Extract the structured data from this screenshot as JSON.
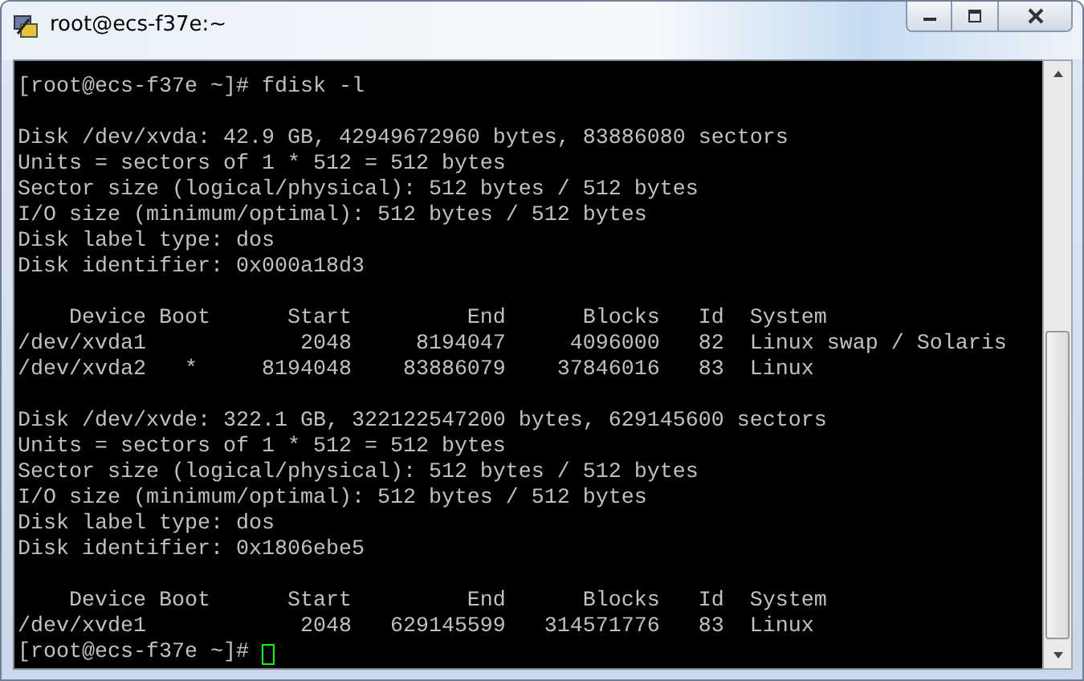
{
  "window": {
    "title": "root@ecs-f37e:~"
  },
  "terminal": {
    "blocks": [
      {
        "lines": [
          "[root@ecs-f37e ~]# fdisk -l"
        ]
      },
      {
        "lines": [
          "Disk /dev/xvda: 42.9 GB, 42949672960 bytes, 83886080 sectors",
          "Units = sectors of 1 * 512 = 512 bytes",
          "Sector size (logical/physical): 512 bytes / 512 bytes",
          "I/O size (minimum/optimal): 512 bytes / 512 bytes",
          "Disk label type: dos",
          "Disk identifier: 0x000a18d3"
        ]
      },
      {
        "lines": [
          "    Device Boot      Start         End      Blocks   Id  System",
          "/dev/xvda1            2048     8194047     4096000   82  Linux swap / Solaris",
          "/dev/xvda2   *     8194048    83886079    37846016   83  Linux"
        ]
      },
      {
        "lines": [
          "Disk /dev/xvde: 322.1 GB, 322122547200 bytes, 629145600 sectors",
          "Units = sectors of 1 * 512 = 512 bytes",
          "Sector size (logical/physical): 512 bytes / 512 bytes",
          "I/O size (minimum/optimal): 512 bytes / 512 bytes",
          "Disk label type: dos",
          "Disk identifier: 0x1806ebe5"
        ]
      },
      {
        "lines": [
          "    Device Boot      Start         End      Blocks   Id  System",
          "/dev/xvde1            2048   629145599   314571776   83  Linux"
        ]
      }
    ],
    "prompt": "[root@ecs-f37e ~]#",
    "cursor": true
  }
}
